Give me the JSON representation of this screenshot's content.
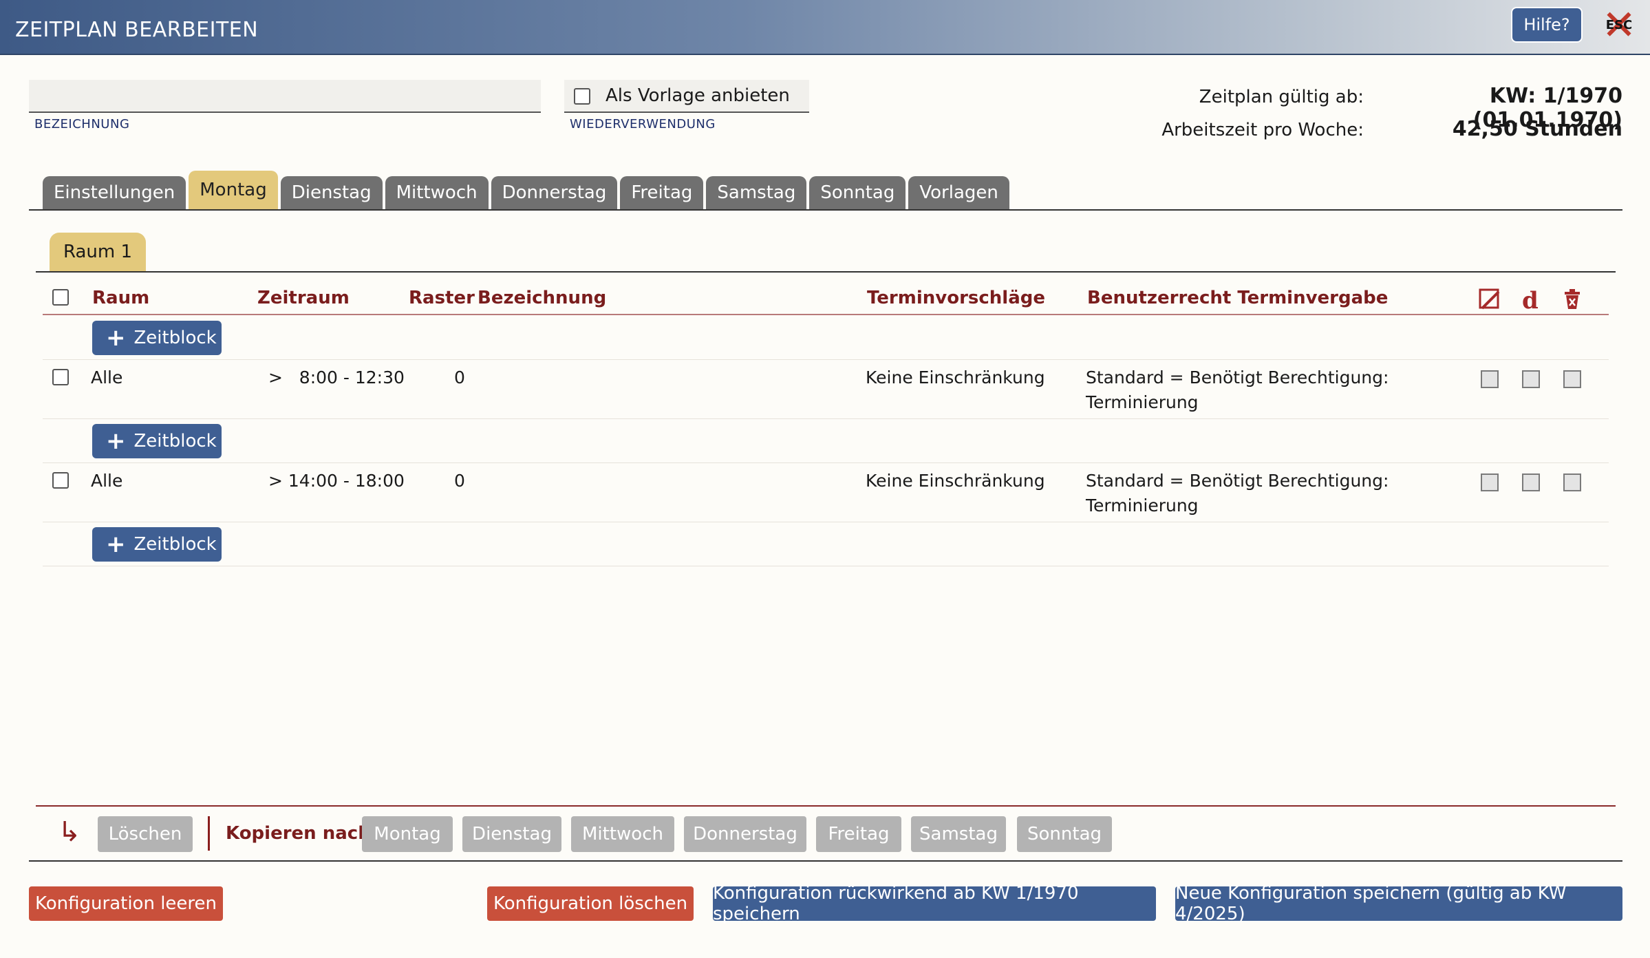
{
  "window": {
    "title": "ZEITPLAN BEARBEITEN",
    "help_label": "Hilfe?",
    "esc_label": "ESC"
  },
  "form": {
    "bezeichnung_value": "",
    "bezeichnung_label": "BEZEICHNUNG",
    "vorlage_label": "Als Vorlage anbieten",
    "wiederverwendung_label": "WIEDERVERWENDUNG"
  },
  "info": {
    "valid_label": "Zeitplan gültig ab:",
    "valid_value": "KW: 1/1970 (01.01.1970)",
    "hours_label": "Arbeitszeit pro Woche:",
    "hours_value": "42,50 Stunden"
  },
  "tabs": [
    "Einstellungen",
    "Montag",
    "Dienstag",
    "Mittwoch",
    "Donnerstag",
    "Freitag",
    "Samstag",
    "Sonntag",
    "Vorlagen"
  ],
  "active_tab": "Montag",
  "subtab": "Raum 1",
  "table": {
    "headers": {
      "raum": "Raum",
      "zeitraum": "Zeitraum",
      "raster": "Raster",
      "bezeichnung": "Bezeichnung",
      "terminvorschlaege": "Terminvorschläge",
      "benutzerrecht": "Benutzerrecht Terminvergabe"
    },
    "zeitblock_label": "Zeitblock",
    "rows": [
      {
        "raum": "Alle",
        "zeitraum": ">   8:00 - 12:30",
        "raster": "0",
        "bezeichnung": "",
        "terminvorschlaege": "Keine Einschränkung",
        "benutzerrecht_1": "Standard = Benötigt Berechtigung:",
        "benutzerrecht_2": "Terminierung"
      },
      {
        "raum": "Alle",
        "zeitraum": "> 14:00 - 18:00",
        "raster": "0",
        "bezeichnung": "",
        "terminvorschlaege": "Keine Einschränkung",
        "benutzerrecht_1": "Standard = Benötigt Berechtigung:",
        "benutzerrecht_2": "Terminierung"
      }
    ]
  },
  "bottom_bar": {
    "delete_label": "Löschen",
    "copy_label": "Kopieren nach:",
    "days": [
      "Montag",
      "Dienstag",
      "Mittwoch",
      "Donnerstag",
      "Freitag",
      "Samstag",
      "Sonntag"
    ]
  },
  "actions": {
    "clear": "Konfiguration leeren",
    "delete": "Konfiguration löschen",
    "save_retro": "Konfiguration rückwirkend ab KW 1/1970 speichern",
    "save_new": "Neue Konfiguration speichern (gültig ab KW 4/2025)"
  },
  "colors": {
    "header_blue": "#3f5f93",
    "accent_red": "#7a1d1d",
    "tab_active": "#e3c97c",
    "danger": "#c9503b"
  },
  "icons": {
    "edit": "edit-icon",
    "duplicate": "d-icon",
    "delete": "trash-icon",
    "plus": "plus-icon",
    "arrow": "return-arrow-icon"
  }
}
